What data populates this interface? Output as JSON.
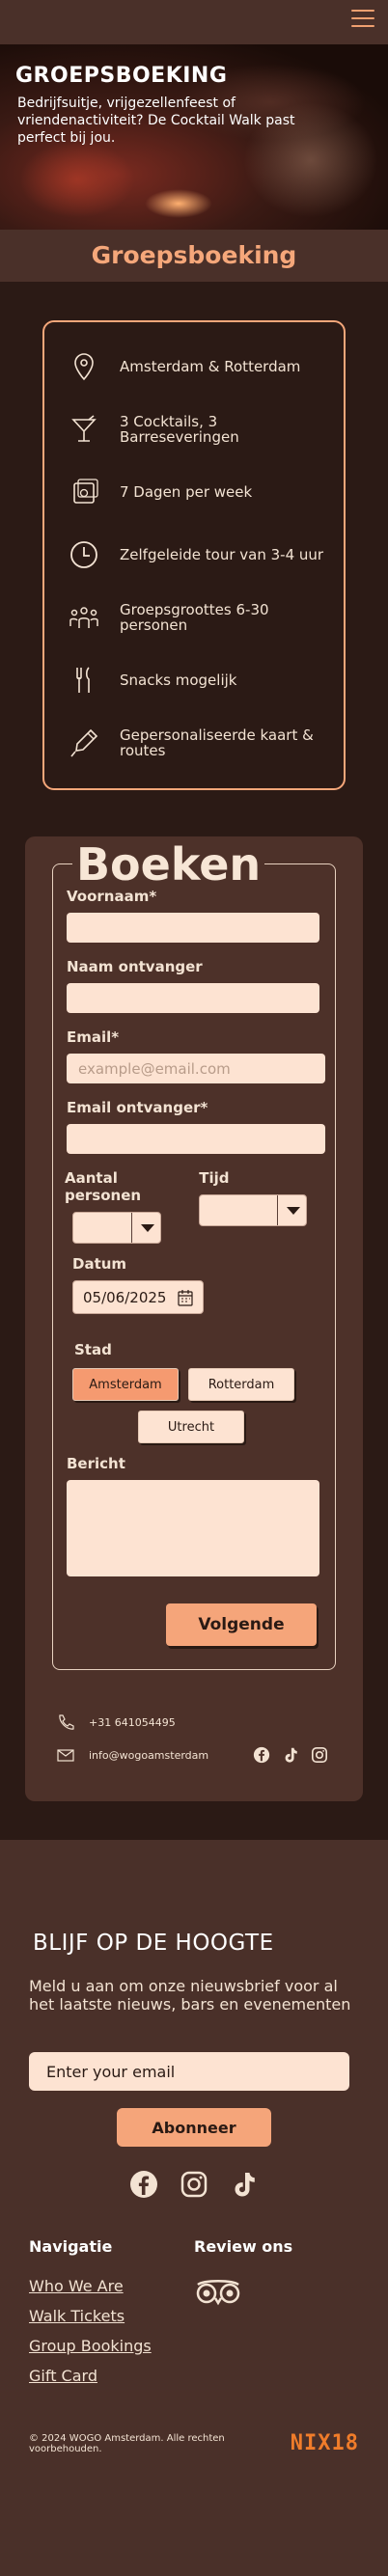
{
  "hero": {
    "title": "GROEPSBOEKING",
    "subtitle": "Bedrijfsuitje, vrijgezellenfeest of vriendenactiviteit? De Cocktail Walk past perfect bij jou."
  },
  "page_heading": "Groepsboeking",
  "features": [
    {
      "icon": "location-pin-icon",
      "text": "Amsterdam & Rotterdam"
    },
    {
      "icon": "cocktail-glass-icon",
      "text": "3 Cocktails, 3 Barreseveringen"
    },
    {
      "icon": "calendar-icon",
      "text": "7 Dagen per week"
    },
    {
      "icon": "clock-icon",
      "text": "Zelfgeleide tour van 3-4 uur"
    },
    {
      "icon": "group-people-icon",
      "text": "Groepsgroottes 6-30 personen"
    },
    {
      "icon": "cutlery-icon",
      "text": "Snacks mogelijk"
    },
    {
      "icon": "pen-icon",
      "text": "Gepersonaliseerde kaart & routes"
    }
  ],
  "form": {
    "legend": "Boeken",
    "first_name_label": "Voornaam*",
    "recipient_name_label": "Naam ontvanger",
    "email_label": "Email*",
    "email_placeholder": "example@email.com",
    "recipient_email_label": "Email ontvanger*",
    "people_label": "Aantal personen",
    "time_label": "Tijd",
    "date_label": "Datum",
    "date_value": "05/06/2025",
    "city_label": "Stad",
    "cities": [
      "Amsterdam",
      "Rotterdam",
      "Utrecht"
    ],
    "selected_city": "Amsterdam",
    "message_label": "Bericht",
    "next_button": "Volgende"
  },
  "contact": {
    "phone": "+31 641054495",
    "email": "info@wogoamsterdam"
  },
  "newsletter": {
    "title": "BLIJF OP DE HOOGTE",
    "subtitle": "Meld u aan om onze nieuwsbrief voor al het laatste nieuws, bars en evenementen",
    "email_placeholder": "Enter your email",
    "button": "Abonneer"
  },
  "footer": {
    "nav_heading": "Navigatie",
    "nav_links": [
      "Who We Are",
      "Walk Tickets",
      "Group Bookings",
      "Gift Card"
    ],
    "review_heading": "Review ons",
    "copyright": "© 2024 WOGO Amsterdam. Alle rechten voorbehouden.",
    "logo_text": "NIX18"
  },
  "colors": {
    "accent": "#f5a77a",
    "background": "#4a3029",
    "dark": "#2b1a15",
    "field": "#fde3d2"
  }
}
